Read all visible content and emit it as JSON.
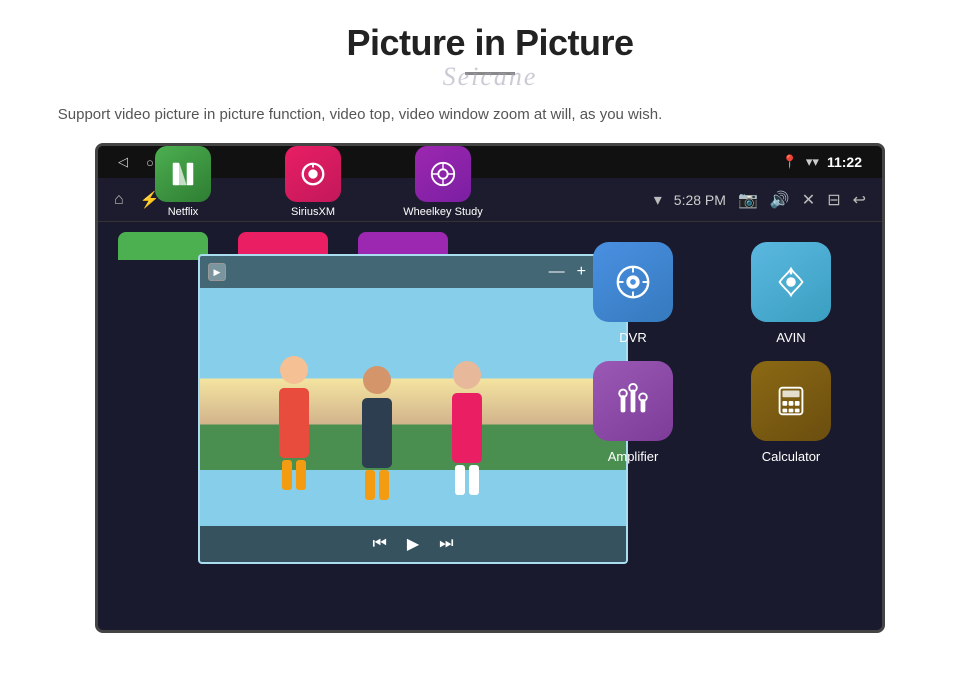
{
  "header": {
    "title": "Picture in Picture",
    "watermark": "Seicane",
    "subtitle": "Support video picture in picture function, video top, video window zoom at will, as you wish."
  },
  "status_bar": {
    "nav_back": "◁",
    "nav_home": "○",
    "nav_square": "□",
    "nav_extra": "▭",
    "wifi_icon": "▾",
    "time": "11:22"
  },
  "toolbar": {
    "home_icon": "⌂",
    "usb_icon": "⚡",
    "wifi_icon": "▾",
    "toolbar_time": "5:28 PM",
    "camera_icon": "📷",
    "volume_icon": "🔊",
    "close_icon": "✕",
    "window_icon": "⊟",
    "back_icon": "↩"
  },
  "apps": {
    "dvr": {
      "label": "DVR"
    },
    "avin": {
      "label": "AVIN"
    },
    "amplifier": {
      "label": "Amplifier"
    },
    "calculator": {
      "label": "Calculator"
    },
    "netflix": {
      "label": "Netflix"
    },
    "siriusxm": {
      "label": "SiriusXM"
    },
    "wheelkey": {
      "label": "Wheelkey Study"
    }
  },
  "pip": {
    "minus": "—",
    "plus": "+",
    "close": "✕",
    "prev": "⏮",
    "play": "▶",
    "next": "⏭"
  }
}
